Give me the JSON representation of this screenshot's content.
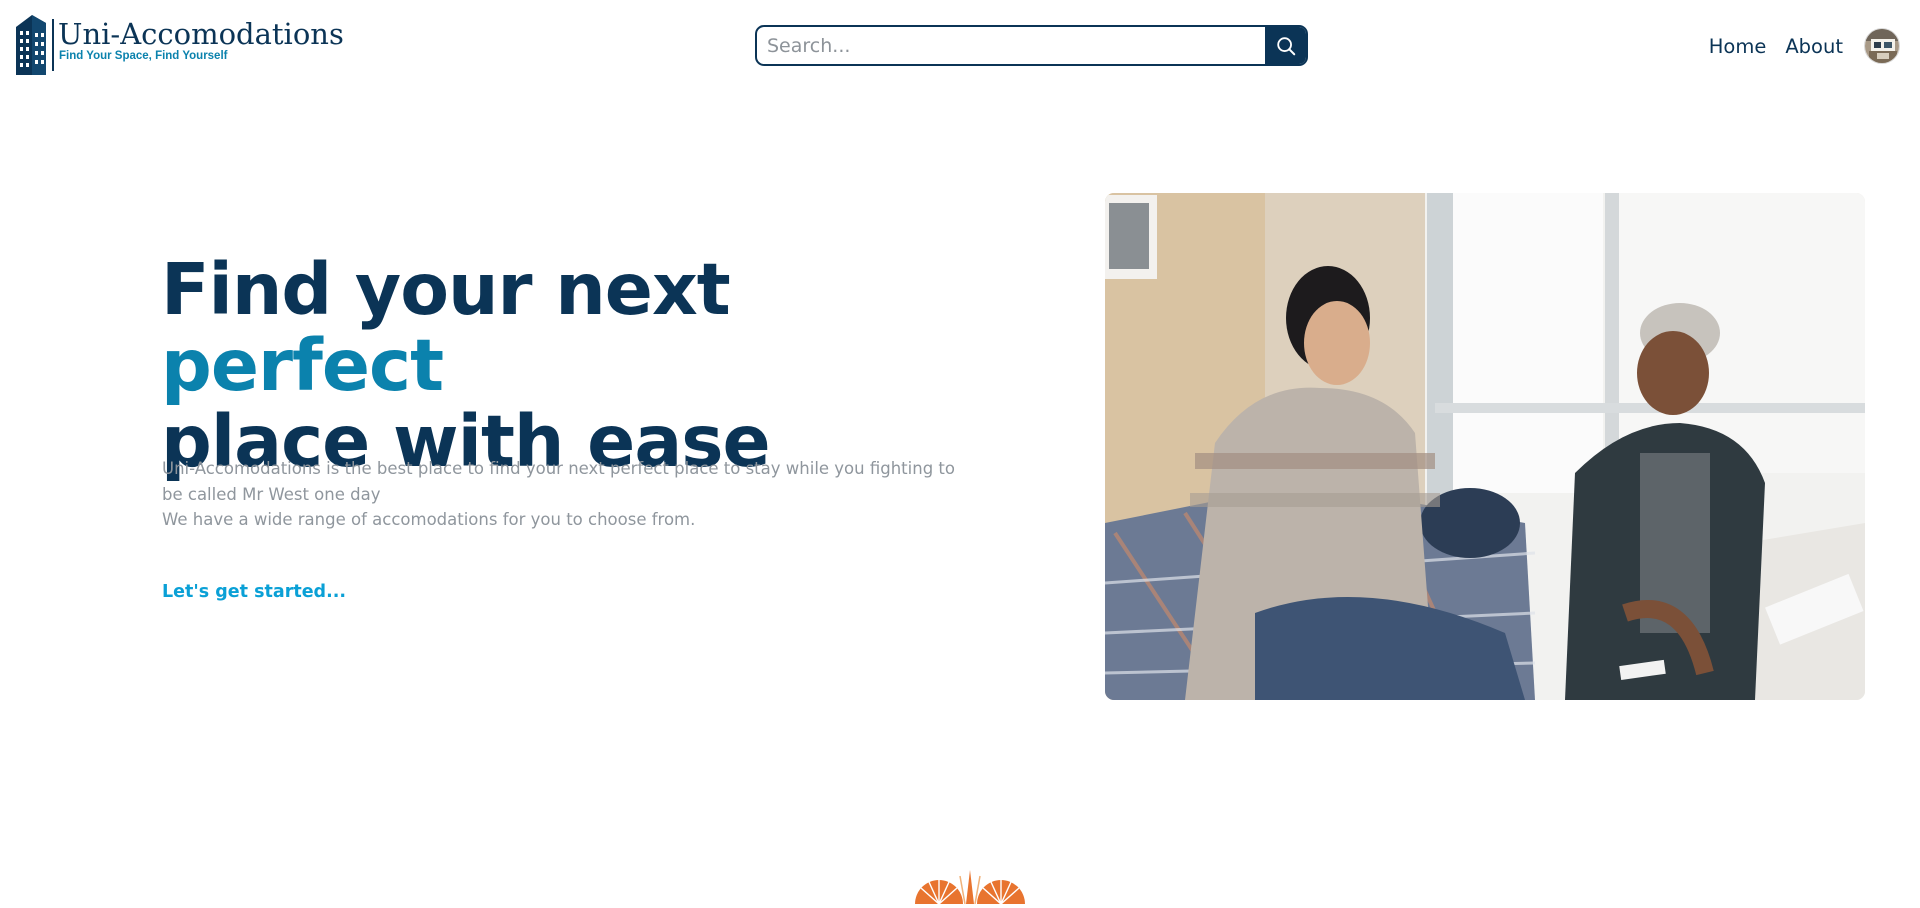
{
  "header": {
    "logo": {
      "name": "Uni-Accomodations",
      "tagline": "Find Your Space, Find Yourself"
    },
    "search": {
      "placeholder": "Search...",
      "value": ""
    },
    "nav": {
      "home": "Home",
      "about": "About"
    }
  },
  "hero": {
    "title_part1": "Find your next ",
    "title_accent": "perfect",
    "title_part2": "place with ease",
    "description_line1": "Uni-Accomodations is the best place to find your next perfect place to stay while you fighting to be called Mr West one day",
    "description_line2": "We have a wide range of accomodations for you to choose from.",
    "cta": "Let's get started..."
  },
  "colors": {
    "primary": "#0b3456",
    "accent": "#0b82ad",
    "link": "#0aa0d6",
    "muted_text": "#8f969d",
    "decor_orange": "#e8742f"
  },
  "icons": {
    "logo": "building-icon",
    "search": "search-icon",
    "avatar": "user-avatar",
    "decor": "sunburst-decor"
  }
}
